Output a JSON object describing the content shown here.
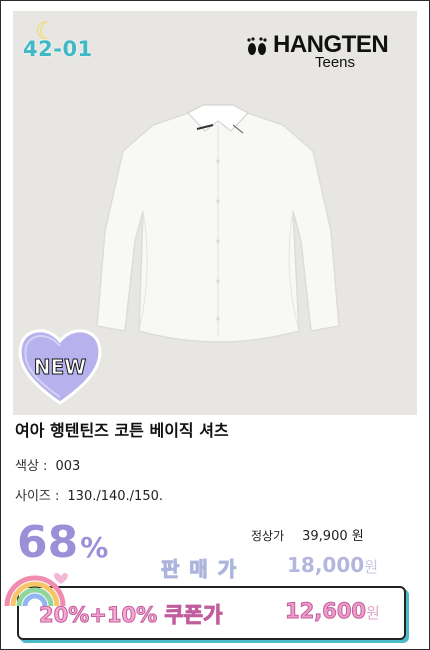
{
  "badge": {
    "code": "42-01",
    "new_label": "NEW"
  },
  "logo": {
    "brand": "HANGTEN",
    "sub": "Teens"
  },
  "product": {
    "title": "여아 행텐틴즈 코튼 베이직 셔츠",
    "color_label": "색상 :",
    "color_value": "003",
    "size_label": "사이즈 :",
    "size_value": "130./140./150."
  },
  "pricing": {
    "discount": "68",
    "discount_unit": "%",
    "regular_label": "정상가",
    "regular_price": "39,900 원",
    "sale_label": "판매가",
    "sale_price": "18,000",
    "sale_unit": "원",
    "coupon_label": "20%+10% 쿠폰가",
    "coupon_price": "12,600",
    "coupon_unit": "원"
  },
  "colors": {
    "accent_purple": "#9b90d8",
    "coupon_pink": "#f5a8d0",
    "badge_teal": "#3fb9c8"
  }
}
